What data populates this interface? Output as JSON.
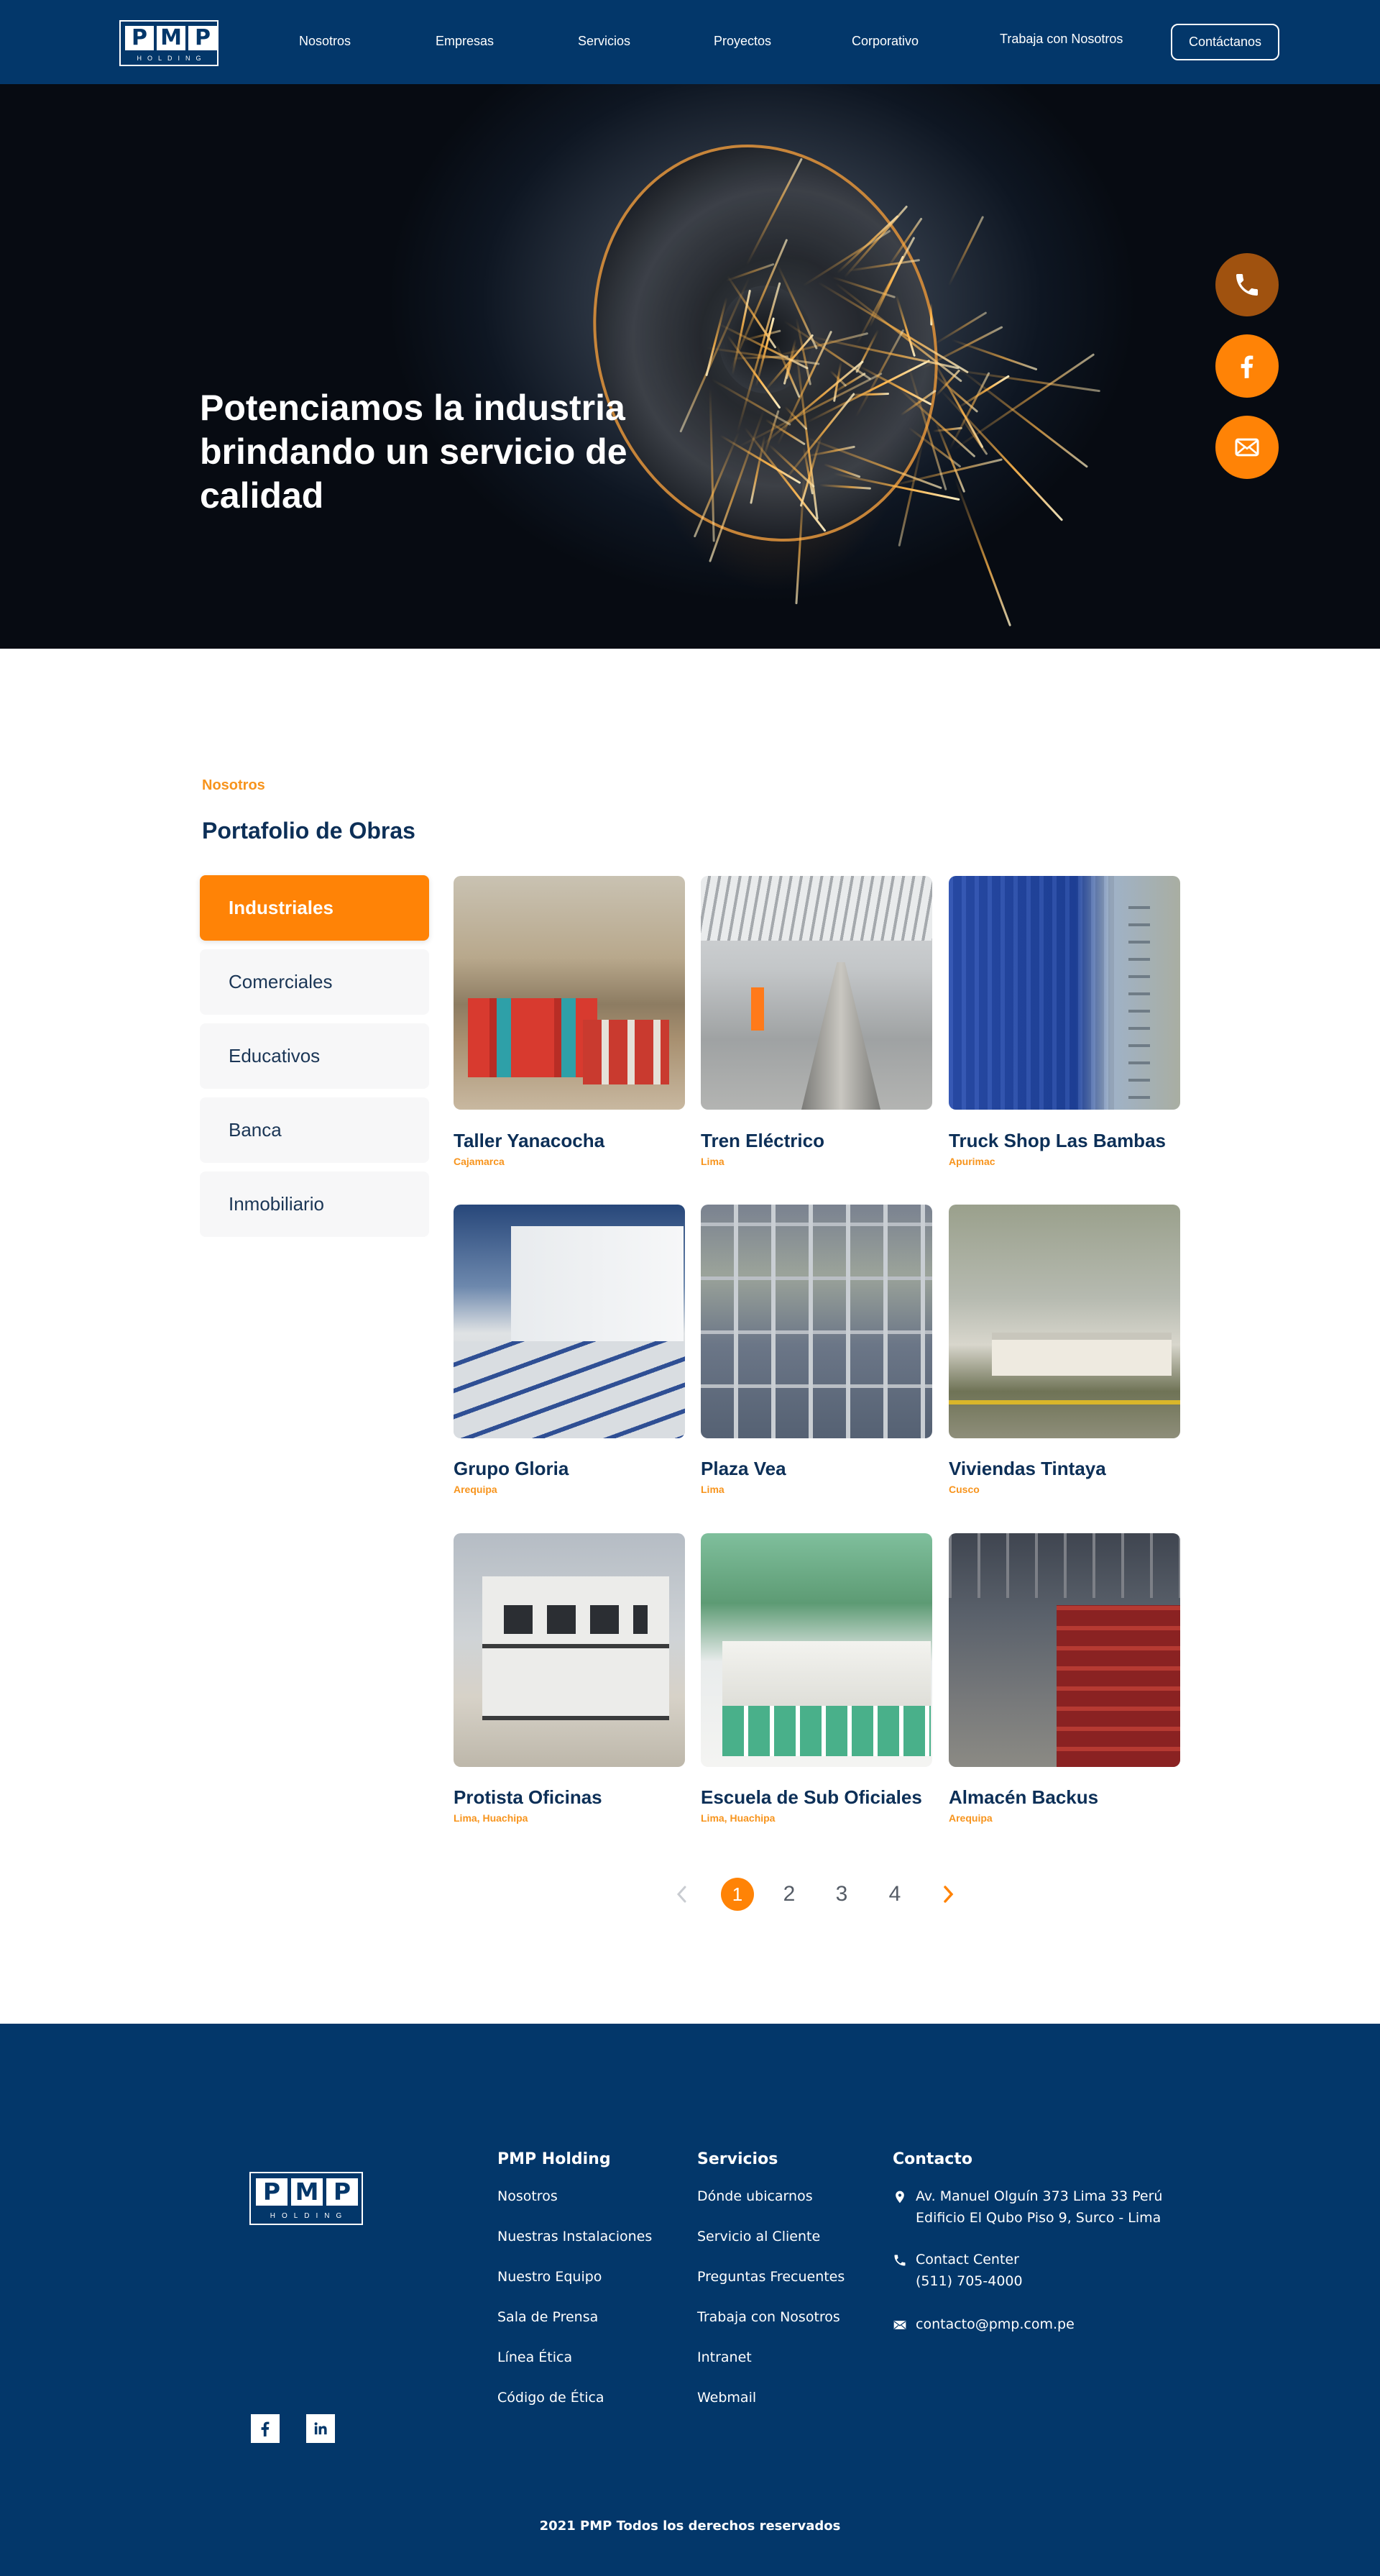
{
  "brand": {
    "letters": [
      "P",
      "M",
      "P"
    ],
    "sub": "HOLDING"
  },
  "nav": {
    "items": [
      "Nosotros",
      "Empresas",
      "Servicios",
      "Proyectos",
      "Corporativo",
      "Trabaja con Nosotros"
    ],
    "cta": "Contáctanos"
  },
  "hero": {
    "title": "Potenciamos la industria brindando un servicio de calidad"
  },
  "floating": {
    "icons": [
      "phone-icon",
      "facebook-icon",
      "mail-icon"
    ],
    "colors": [
      "#a0520f",
      "#ff8306",
      "#ff8306"
    ]
  },
  "portfolio": {
    "eyebrow": "Nosotros",
    "title": "Portafolio de Obras",
    "categories": [
      "Industriales",
      "Comerciales",
      "Educativos",
      "Banca",
      "Inmobiliario"
    ],
    "active_category": "Industriales",
    "projects": [
      {
        "title": "Taller Yanacocha",
        "location": "Cajamarca"
      },
      {
        "title": "Tren Eléctrico",
        "location": "Lima"
      },
      {
        "title": "Truck Shop Las Bambas",
        "location": "Apurimac"
      },
      {
        "title": "Grupo Gloria",
        "location": "Arequipa"
      },
      {
        "title": "Plaza Vea",
        "location": "Lima"
      },
      {
        "title": "Viviendas Tintaya",
        "location": "Cusco"
      },
      {
        "title": "Protista Oficinas",
        "location": "Lima, Huachipa"
      },
      {
        "title": "Escuela de Sub Oficiales",
        "location": "Lima, Huachipa"
      },
      {
        "title": "Almacén Backus",
        "location": "Arequipa"
      }
    ]
  },
  "pagination": {
    "pages": [
      "1",
      "2",
      "3",
      "4"
    ],
    "current": "1"
  },
  "footer": {
    "col1": {
      "title": "PMP Holding",
      "links": [
        "Nosotros",
        "Nuestras Instalaciones",
        "Nuestro Equipo",
        "Sala de Prensa",
        "Línea Ética",
        "Código de Ética"
      ]
    },
    "col2": {
      "title": "Servicios",
      "links": [
        "Dónde ubicarnos",
        "Servicio al Cliente",
        "Preguntas Frecuentes",
        "Trabaja con Nosotros",
        "Intranet",
        "Webmail"
      ]
    },
    "contact": {
      "title": "Contacto",
      "address_line1": "Av. Manuel Olguín 373 Lima 33 Perú",
      "address_line2": "Edificio El Qubo Piso 9, Surco - Lima",
      "center_label": "Contact Center",
      "center_phone": "(511) 705-4000",
      "email": "contacto@pmp.com.pe"
    },
    "social": [
      "facebook-icon",
      "linkedin-icon"
    ],
    "copyright": "2021 PMP Todos los derechos reservados"
  },
  "colors": {
    "navy": "#03376a",
    "orange": "#ff8306",
    "title": "#0c2f57",
    "accent_text": "#f7941d"
  }
}
